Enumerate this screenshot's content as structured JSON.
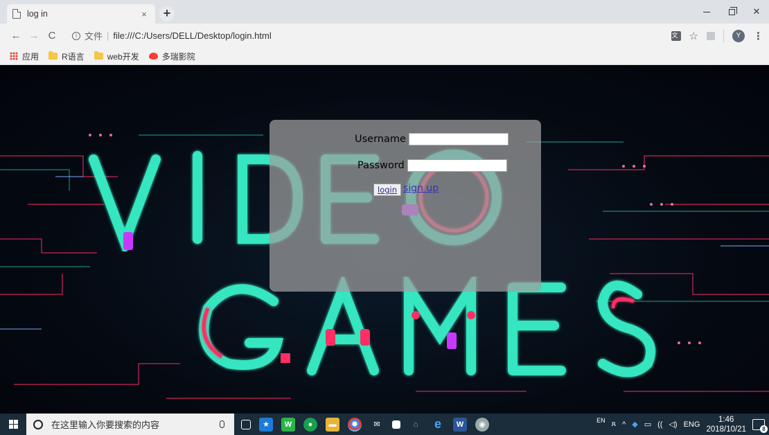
{
  "browser": {
    "tab_title": "log in",
    "tab_close": "×",
    "new_tab": "+",
    "url_scheme_label": "文件",
    "url": "file:///C:/Users/DELL/Desktop/login.html",
    "avatar_letter": "Y"
  },
  "bookmarks": [
    {
      "label": "应用",
      "icon": "apps-icon"
    },
    {
      "label": "R语言",
      "icon": "folder-icon"
    },
    {
      "label": "web开发",
      "icon": "folder-icon"
    },
    {
      "label": "多瑞影院",
      "icon": "pill-icon"
    }
  ],
  "login": {
    "username_label": "Username",
    "password_label": "Password",
    "login_button": "login",
    "signup_link": "sign up"
  },
  "taskbar": {
    "search_placeholder": "在这里输入你要搜索的内容",
    "ime_indicator": "EN",
    "language": "ENG",
    "time": "1:46",
    "date": "2018/10/21",
    "notifications_count": "8"
  }
}
